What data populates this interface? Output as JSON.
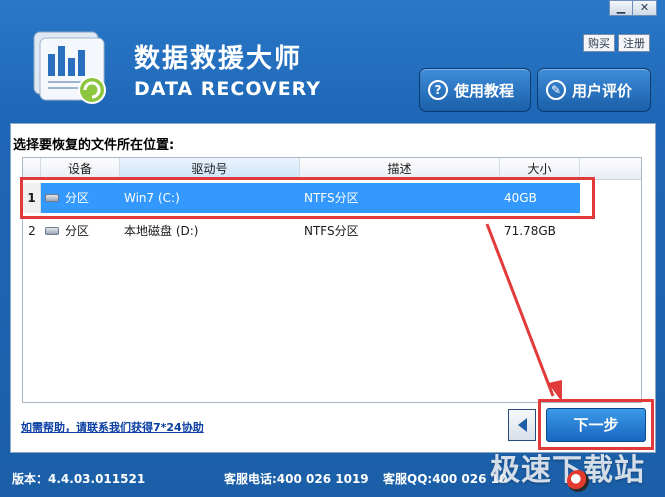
{
  "window_controls": {
    "minimize": "▁",
    "close": "✕"
  },
  "header": {
    "title_cn": "数据救援大师",
    "title_en": "DATA RECOVERY",
    "buy_label": "购买",
    "register_label": "注册",
    "tutorial_label": "使用教程",
    "review_label": "用户评价"
  },
  "main": {
    "prompt": "选择要恢复的文件所在位置:",
    "columns": [
      "设备",
      "驱动号",
      "描述",
      "大小"
    ],
    "rows": [
      {
        "index": "1",
        "device": "分区",
        "drive": "Win7 (C:)",
        "desc": "NTFS分区",
        "size": "40GB"
      },
      {
        "index": "2",
        "device": "分区",
        "drive": "本地磁盘 (D:)",
        "desc": "NTFS分区",
        "size": "71.78GB"
      }
    ],
    "help_link": "如需帮助，请联系我们获得7*24协助",
    "next_label": "下一步"
  },
  "footer": {
    "version": "版本：4.4.03.011521",
    "phone": "客服电话:400 026 1019",
    "qq": "客服QQ:400 026 10"
  },
  "watermark": "极速下载站",
  "colors": {
    "selected_row": "#3399ff",
    "highlight": "#e03a3a",
    "window_blue": "#1b5fa8"
  }
}
